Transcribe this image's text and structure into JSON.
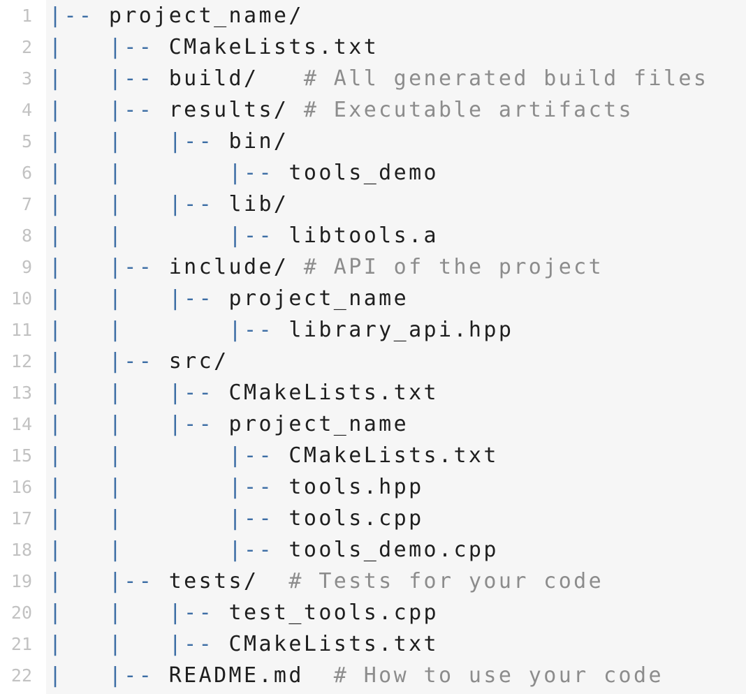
{
  "lines": [
    {
      "n": "1",
      "tree": "|-- ",
      "name": "project_name/",
      "comment": ""
    },
    {
      "n": "2",
      "tree": "|   |-- ",
      "name": "CMakeLists.txt",
      "comment": ""
    },
    {
      "n": "3",
      "tree": "|   |-- ",
      "name": "build/",
      "comment": "   # All generated build files"
    },
    {
      "n": "4",
      "tree": "|   |-- ",
      "name": "results/",
      "comment": " # Executable artifacts"
    },
    {
      "n": "5",
      "tree": "|   |   |-- ",
      "name": "bin/",
      "comment": ""
    },
    {
      "n": "6",
      "tree": "|   |       |-- ",
      "name": "tools_demo",
      "comment": ""
    },
    {
      "n": "7",
      "tree": "|   |   |-- ",
      "name": "lib/",
      "comment": ""
    },
    {
      "n": "8",
      "tree": "|   |       |-- ",
      "name": "libtools.a",
      "comment": ""
    },
    {
      "n": "9",
      "tree": "|   |-- ",
      "name": "include/",
      "comment": " # API of the project"
    },
    {
      "n": "10",
      "tree": "|   |   |-- ",
      "name": "project_name",
      "comment": ""
    },
    {
      "n": "11",
      "tree": "|   |       |-- ",
      "name": "library_api.hpp",
      "comment": ""
    },
    {
      "n": "12",
      "tree": "|   |-- ",
      "name": "src/",
      "comment": ""
    },
    {
      "n": "13",
      "tree": "|   |   |-- ",
      "name": "CMakeLists.txt",
      "comment": ""
    },
    {
      "n": "14",
      "tree": "|   |   |-- ",
      "name": "project_name",
      "comment": ""
    },
    {
      "n": "15",
      "tree": "|   |       |-- ",
      "name": "CMakeLists.txt",
      "comment": ""
    },
    {
      "n": "16",
      "tree": "|   |       |-- ",
      "name": "tools.hpp",
      "comment": ""
    },
    {
      "n": "17",
      "tree": "|   |       |-- ",
      "name": "tools.cpp",
      "comment": ""
    },
    {
      "n": "18",
      "tree": "|   |       |-- ",
      "name": "tools_demo.cpp",
      "comment": ""
    },
    {
      "n": "19",
      "tree": "|   |-- ",
      "name": "tests/",
      "comment": "  # Tests for your code"
    },
    {
      "n": "20",
      "tree": "|   |   |-- ",
      "name": "test_tools.cpp",
      "comment": ""
    },
    {
      "n": "21",
      "tree": "|   |   |-- ",
      "name": "CMakeLists.txt",
      "comment": ""
    },
    {
      "n": "22",
      "tree": "|   |-- ",
      "name": "README.md",
      "comment": "  # How to use your code"
    }
  ],
  "colors": {
    "tree": "#3d6ea5",
    "text": "#1e1e1e",
    "comment": "#8c8c8c",
    "line_number": "#c2c2c2",
    "background": "#f6f6f6"
  }
}
